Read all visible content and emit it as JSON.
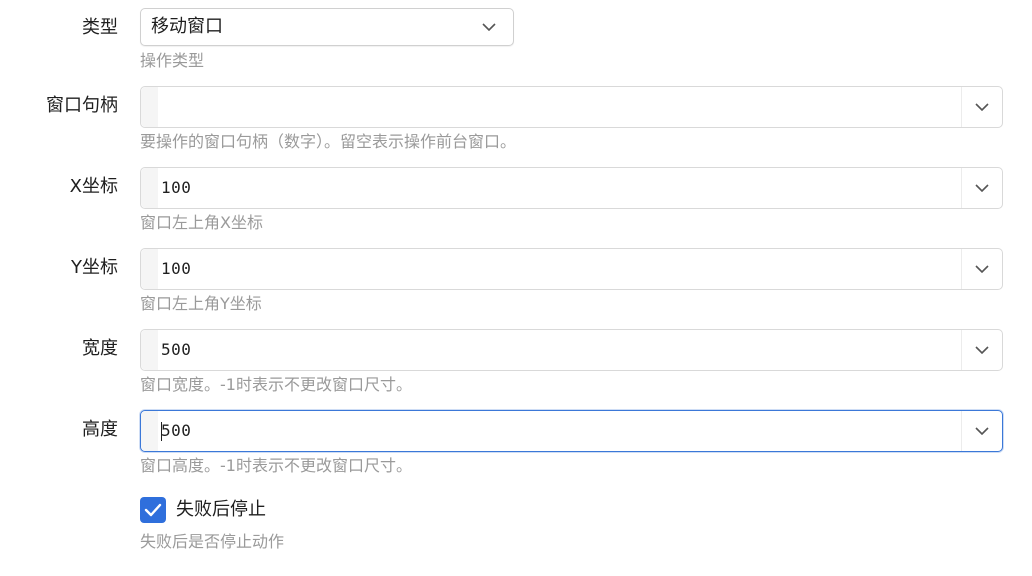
{
  "fields": {
    "type": {
      "label": "类型",
      "value": "移动窗口",
      "hint": "操作类型"
    },
    "handle": {
      "label": "窗口句柄",
      "value": "",
      "hint": "要操作的窗口句柄（数字）。留空表示操作前台窗口。"
    },
    "x": {
      "label": "X坐标",
      "value": "100",
      "hint": "窗口左上角X坐标"
    },
    "y": {
      "label": "Y坐标",
      "value": "100",
      "hint": "窗口左上角Y坐标"
    },
    "width": {
      "label": "宽度",
      "value": "500",
      "hint": "窗口宽度。-1时表示不更改窗口尺寸。"
    },
    "height": {
      "label": "高度",
      "value": "500",
      "hint": "窗口高度。-1时表示不更改窗口尺寸。"
    }
  },
  "stop_on_fail": {
    "label": "失败后停止",
    "checked": true,
    "hint": "失败后是否停止动作"
  },
  "colors": {
    "accent": "#2f6fdc",
    "focus_border": "#3b78d8",
    "hint": "#9a9a9a"
  },
  "icons": {
    "dropdown": "chevron-down-icon",
    "check": "check-icon"
  }
}
